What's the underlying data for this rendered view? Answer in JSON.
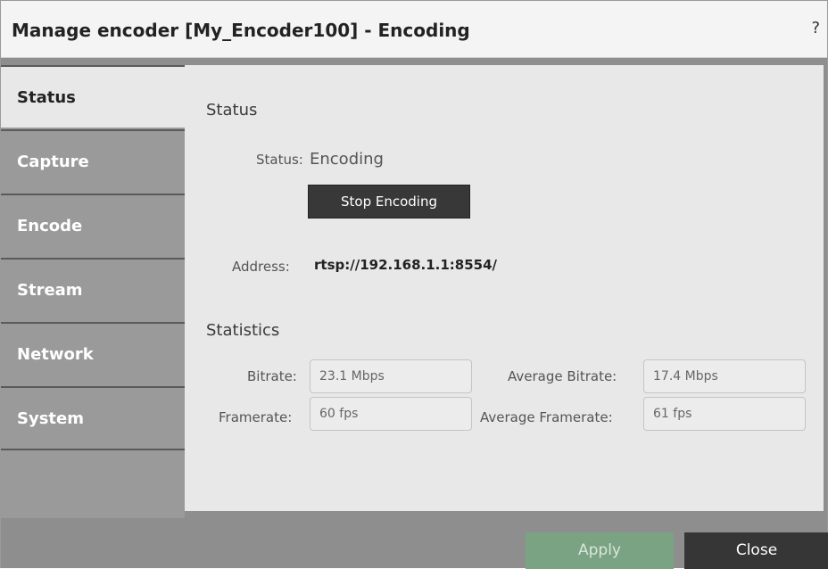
{
  "dialog": {
    "title": "Manage encoder [My_Encoder100] - Encoding",
    "help_label": "?"
  },
  "sidebar": {
    "tabs": [
      {
        "label": "Status",
        "active": true
      },
      {
        "label": "Capture",
        "active": false
      },
      {
        "label": "Encode",
        "active": false
      },
      {
        "label": "Stream",
        "active": false
      },
      {
        "label": "Network",
        "active": false
      },
      {
        "label": "System",
        "active": false
      }
    ]
  },
  "status_section": {
    "heading": "Status",
    "status_label": "Status:",
    "status_value": "Encoding",
    "stop_button_label": "Stop Encoding",
    "address_label": "Address:",
    "address_value": "rtsp://192.168.1.1:8554/"
  },
  "statistics_section": {
    "heading": "Statistics",
    "bitrate_label": "Bitrate:",
    "bitrate_value": "23.1 Mbps",
    "average_bitrate_label": "Average Bitrate:",
    "average_bitrate_value": "17.4 Mbps",
    "framerate_label": "Framerate:",
    "framerate_value": "60 fps",
    "average_framerate_label": "Average Framerate:",
    "average_framerate_value": "61 fps"
  },
  "footer": {
    "apply_label": "Apply",
    "close_label": "Close"
  },
  "colors": {
    "apply_button": "#7aa383",
    "close_button": "#363636",
    "stop_button": "#383838",
    "sidebar": "#9a9a9a",
    "content": "#e8e8e8"
  }
}
